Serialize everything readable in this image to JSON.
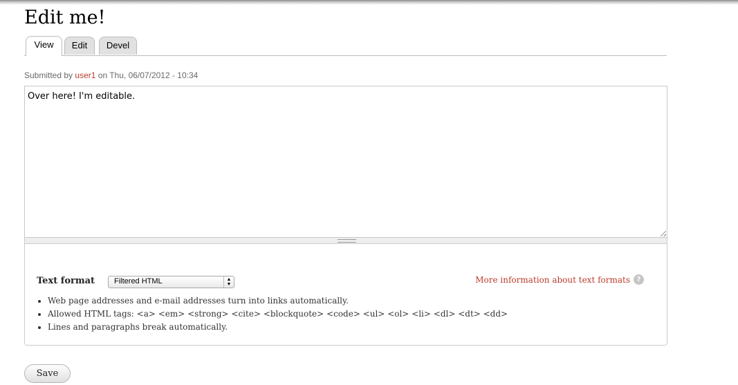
{
  "page": {
    "title": "Edit me!"
  },
  "tabs": [
    {
      "label": "View",
      "active": true
    },
    {
      "label": "Edit",
      "active": false
    },
    {
      "label": "Devel",
      "active": false
    }
  ],
  "submitted": {
    "prefix": "Submitted by",
    "user": "user1",
    "date_text": "on Thu, 06/07/2012 - 10:34"
  },
  "editor": {
    "content": "Over here! I'm editable."
  },
  "text_format": {
    "label": "Text format",
    "selected": "Filtered HTML",
    "more_info_label": "More information about text formats",
    "help_icon": "?",
    "tips": [
      "Web page addresses and e-mail addresses turn into links automatically.",
      "Allowed HTML tags: <a> <em> <strong> <cite> <blockquote> <code> <ul> <ol> <li> <dl> <dt> <dd>",
      "Lines and paragraphs break automatically."
    ]
  },
  "actions": {
    "save_label": "Save"
  },
  "colors": {
    "link": "#bb3b2a",
    "tab_inactive_bg": "#e1e1e1",
    "border": "#cccccc"
  }
}
